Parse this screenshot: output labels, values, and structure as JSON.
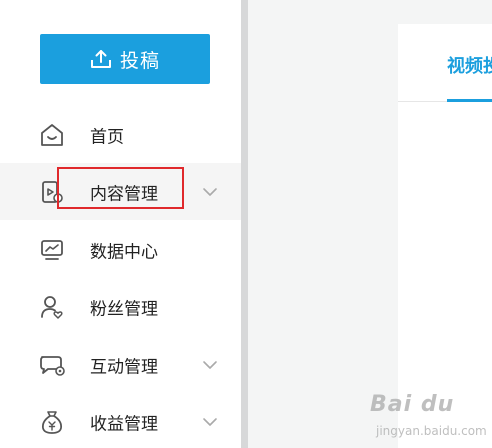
{
  "sidebar": {
    "upload_button": {
      "label": "投稿",
      "icon": "upload-icon"
    },
    "items": [
      {
        "label": "首页",
        "icon": "home-icon",
        "has_chevron": false,
        "active": false
      },
      {
        "label": "内容管理",
        "icon": "content-video-icon",
        "has_chevron": true,
        "active": true
      },
      {
        "label": "数据中心",
        "icon": "monitor-chart-icon",
        "has_chevron": false,
        "active": false
      },
      {
        "label": "粉丝管理",
        "icon": "user-heart-icon",
        "has_chevron": false,
        "active": false
      },
      {
        "label": "互动管理",
        "icon": "chat-bubble-icon",
        "has_chevron": true,
        "active": false
      },
      {
        "label": "收益管理",
        "icon": "money-bag-icon",
        "has_chevron": true,
        "active": false
      }
    ]
  },
  "main": {
    "active_tab": "视频投"
  },
  "watermark": {
    "main": "Bai du",
    "sub": "jingyan.baidu.com"
  },
  "colors": {
    "accent": "#1b9fde",
    "highlight": "#e0292c",
    "sidebar_border": "#d7d8d9"
  }
}
